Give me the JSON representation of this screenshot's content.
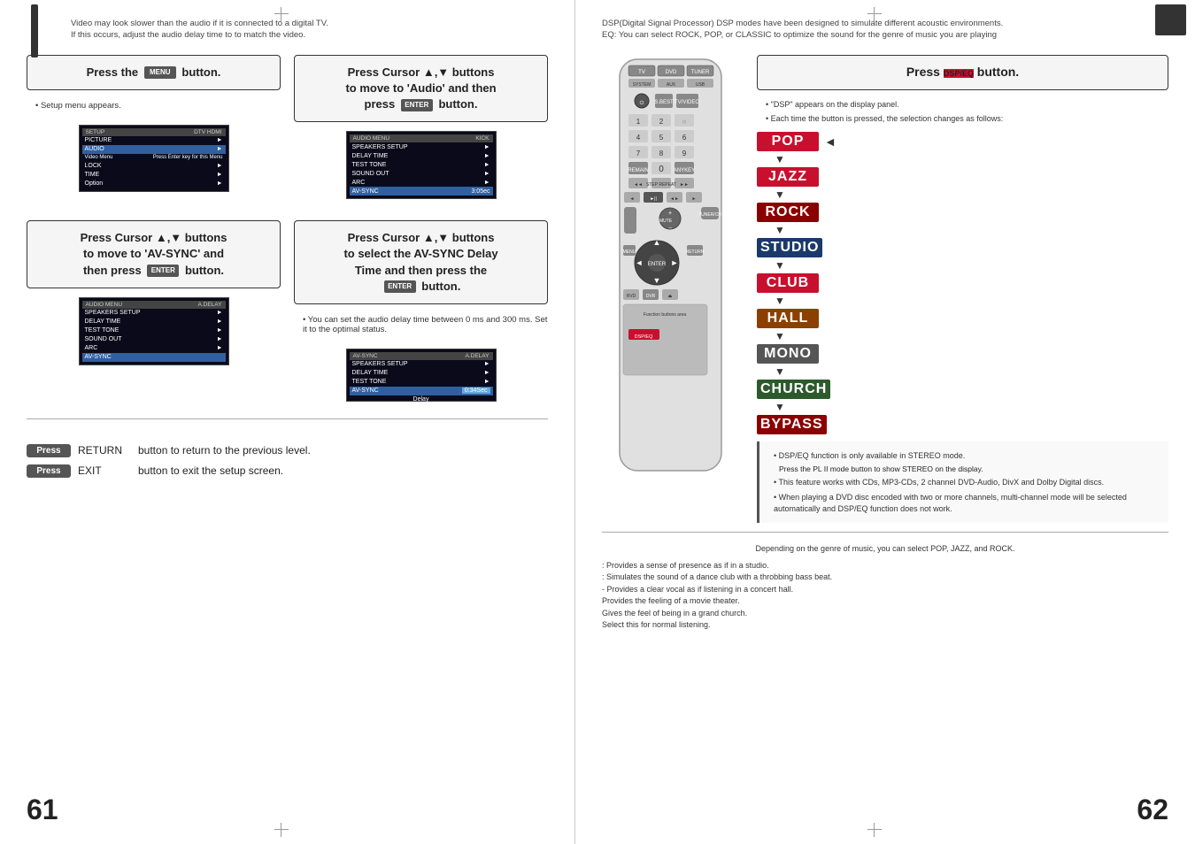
{
  "left_page": {
    "page_number": "61",
    "top_note_line1": "Video may look slower than the audio if it is connected to a digital TV.",
    "top_note_line2": "If this occurs, adjust the audio delay time to to match the video.",
    "step1": {
      "label": "Press the",
      "button_label": "MENU",
      "suffix": "button.",
      "bullet": "Setup menu appears."
    },
    "step2": {
      "label": "Press Cursor ▲,▼ buttons to move to 'Audio' and then press",
      "button_label": "ENTER",
      "suffix": "button."
    },
    "step3": {
      "label": "Press Cursor ▲,▼  buttons to move to 'AV-SYNC' and then press",
      "button_label": "ENTER",
      "suffix": "button."
    },
    "step4": {
      "label": "Press Cursor ▲,▼  buttons to select the AV-SYNC Delay Time  and then press the",
      "button_label": "ENTER",
      "suffix": "button.",
      "bullet": "You can set the audio delay time between 0 ms and 300 ms. Set it to the optimal status."
    },
    "screen1_header_left": "SETUP",
    "screen1_header_right": "DTV HDMI",
    "screen1_rows": [
      {
        "label": "PICTURE",
        "value": ""
      },
      {
        "label": "AUDIO",
        "value": "►",
        "highlight": false
      },
      {
        "label": "Video Menu",
        "value": "Press Enter key for this Menu",
        "highlight": false
      },
      {
        "label": "LOCK",
        "value": ""
      },
      {
        "label": "TIME",
        "value": ""
      },
      {
        "label": "Option",
        "value": ""
      }
    ],
    "screen2_header_left": "AUDIO MENU",
    "screen2_header_right": "KICK",
    "screen2_rows": [
      {
        "label": "SPEAKERS SETUP",
        "value": "►"
      },
      {
        "label": "DELAY TIME",
        "value": "►"
      },
      {
        "label": "TEST TONE",
        "value": "►"
      },
      {
        "label": "SOUND OUT",
        "value": "►"
      },
      {
        "label": "ARC",
        "value": "►"
      },
      {
        "label": "AV-SYNC",
        "value": "3:05ec",
        "highlight": true
      }
    ],
    "screen3_header_left": "AUDIO MENU",
    "screen3_header_right": "A.DELAY",
    "screen3_rows": [
      {
        "label": "SPEAKERS SETUP",
        "value": "►"
      },
      {
        "label": "DELAY TIME",
        "value": "►"
      },
      {
        "label": "TEST TONE",
        "value": "►"
      },
      {
        "label": "SOUND OUT",
        "value": "►"
      },
      {
        "label": "ARC",
        "value": "►"
      },
      {
        "label": "AV-SYNC",
        "value": "",
        "highlight": true
      }
    ],
    "screen4_header_left": "AV-SYNC",
    "screen4_content": "Delay",
    "press_return_label": "Press",
    "press_return_btn": "RETURN",
    "press_return_text": "button to return to the previous level.",
    "press_exit_label": "Press",
    "press_exit_btn": "EXIT",
    "press_exit_text": "button to exit the setup screen."
  },
  "right_page": {
    "page_number": "62",
    "top_note_line1": "DSP(Digital Signal Processor) DSP modes have been designed to simulate different acoustic environments.",
    "top_note_line2": "EQ: You can select ROCK, POP, or CLASSIC to optimize the sound for the genre of music you are playing",
    "dsp_title": "Press",
    "dsp_button": "DSP/EQ",
    "dsp_suffix": "button.",
    "bullet1": "\"DSP\" appears on the display panel.",
    "bullet2": "Each time the button is pressed, the selection changes as follows:",
    "eq_modes": [
      {
        "name": "POP",
        "class": "pop",
        "arrow": "◄"
      },
      {
        "name": "JAZZ",
        "class": "jazz",
        "arrow": ""
      },
      {
        "name": "ROCK",
        "class": "rock",
        "arrow": ""
      },
      {
        "name": "STUDIO",
        "class": "studio",
        "arrow": ""
      },
      {
        "name": "CLUB",
        "class": "club",
        "arrow": ""
      },
      {
        "name": "HALL",
        "class": "hall",
        "arrow": ""
      },
      {
        "name": "MONO",
        "class": "mono",
        "arrow": ""
      },
      {
        "name": "CHURCH",
        "class": "church",
        "arrow": ""
      },
      {
        "name": "BYPASS",
        "class": "bypass",
        "arrow": ""
      }
    ],
    "note_stereo": "DSP/EQ function is only available in STEREO mode.",
    "note_pl2": "Press the  PL II mode button to show STEREO on the display.",
    "note_feature": "This feature works with CDs, MP3-CDs, 2 channel DVD-Audio, DivX and Dolby Digital discs.",
    "note_multichannel": "When playing a DVD disc encoded with two or more channels, multi-channel mode will be selected automatically and DSP/EQ function does not work.",
    "bottom_center": "Depending on the genre of music, you can select POP, JAZZ, and ROCK.",
    "bottom_items": [
      ": Provides a sense of presence as if in a studio.",
      ": Simulates the sound of a dance club with a throbbing bass beat.",
      "- Provides a clear vocal as if listening in a concert hall.",
      "  Provides the feeling of a movie theater.",
      "     Gives the feel of being in a grand church.",
      "Select this for normal listening."
    ]
  }
}
